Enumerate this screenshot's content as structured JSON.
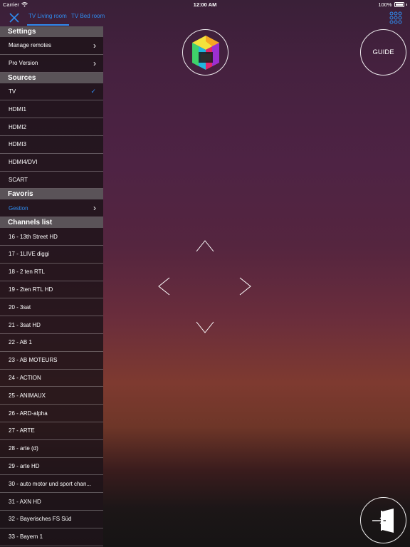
{
  "status_bar": {
    "carrier": "Carrier",
    "time": "12:00 AM",
    "battery": "100%"
  },
  "tabs": [
    {
      "label": "TV Living room",
      "active": true
    },
    {
      "label": "TV Bed room",
      "active": false
    }
  ],
  "sidebar": {
    "settings": {
      "header": "Settings",
      "items": [
        {
          "label": "Manage remotes"
        },
        {
          "label": "Pro Version"
        }
      ]
    },
    "sources": {
      "header": "Sources",
      "items": [
        {
          "label": "TV",
          "selected": true
        },
        {
          "label": "HDMI1"
        },
        {
          "label": "HDMI2"
        },
        {
          "label": "HDMI3"
        },
        {
          "label": "HDMI4/DVI"
        },
        {
          "label": "SCART"
        }
      ]
    },
    "favoris": {
      "header": "Favoris",
      "items": [
        {
          "label": "Gestion"
        }
      ]
    },
    "channels": {
      "header": "Channels list",
      "items": [
        {
          "label": "16 - 13th Street HD"
        },
        {
          "label": "17 - 1LIVE diggi"
        },
        {
          "label": "18 - 2 ten RTL"
        },
        {
          "label": "19 - 2ten RTL HD"
        },
        {
          "label": "20 - 3sat"
        },
        {
          "label": "21 - 3sat HD"
        },
        {
          "label": "22 - AB 1"
        },
        {
          "label": "23 - AB MOTEURS"
        },
        {
          "label": "24 - ACTION"
        },
        {
          "label": "25 - ANIMAUX"
        },
        {
          "label": "26 - ARD-alpha"
        },
        {
          "label": "27 - ARTE"
        },
        {
          "label": "28 - arte (d)"
        },
        {
          "label": "29 - arte HD"
        },
        {
          "label": "30 - auto motor und sport chan..."
        },
        {
          "label": "31 - AXN HD"
        },
        {
          "label": "32 - Bayerisches FS Süd"
        },
        {
          "label": "33 - Bayern 1"
        }
      ]
    }
  },
  "remote": {
    "guide_label": "GUIDE",
    "logo_icon": "smart-hub-cube-icon",
    "exit_icon": "exit-door-icon"
  },
  "colors": {
    "accent": "#2f8cf0",
    "section_header": "#5a5358"
  }
}
